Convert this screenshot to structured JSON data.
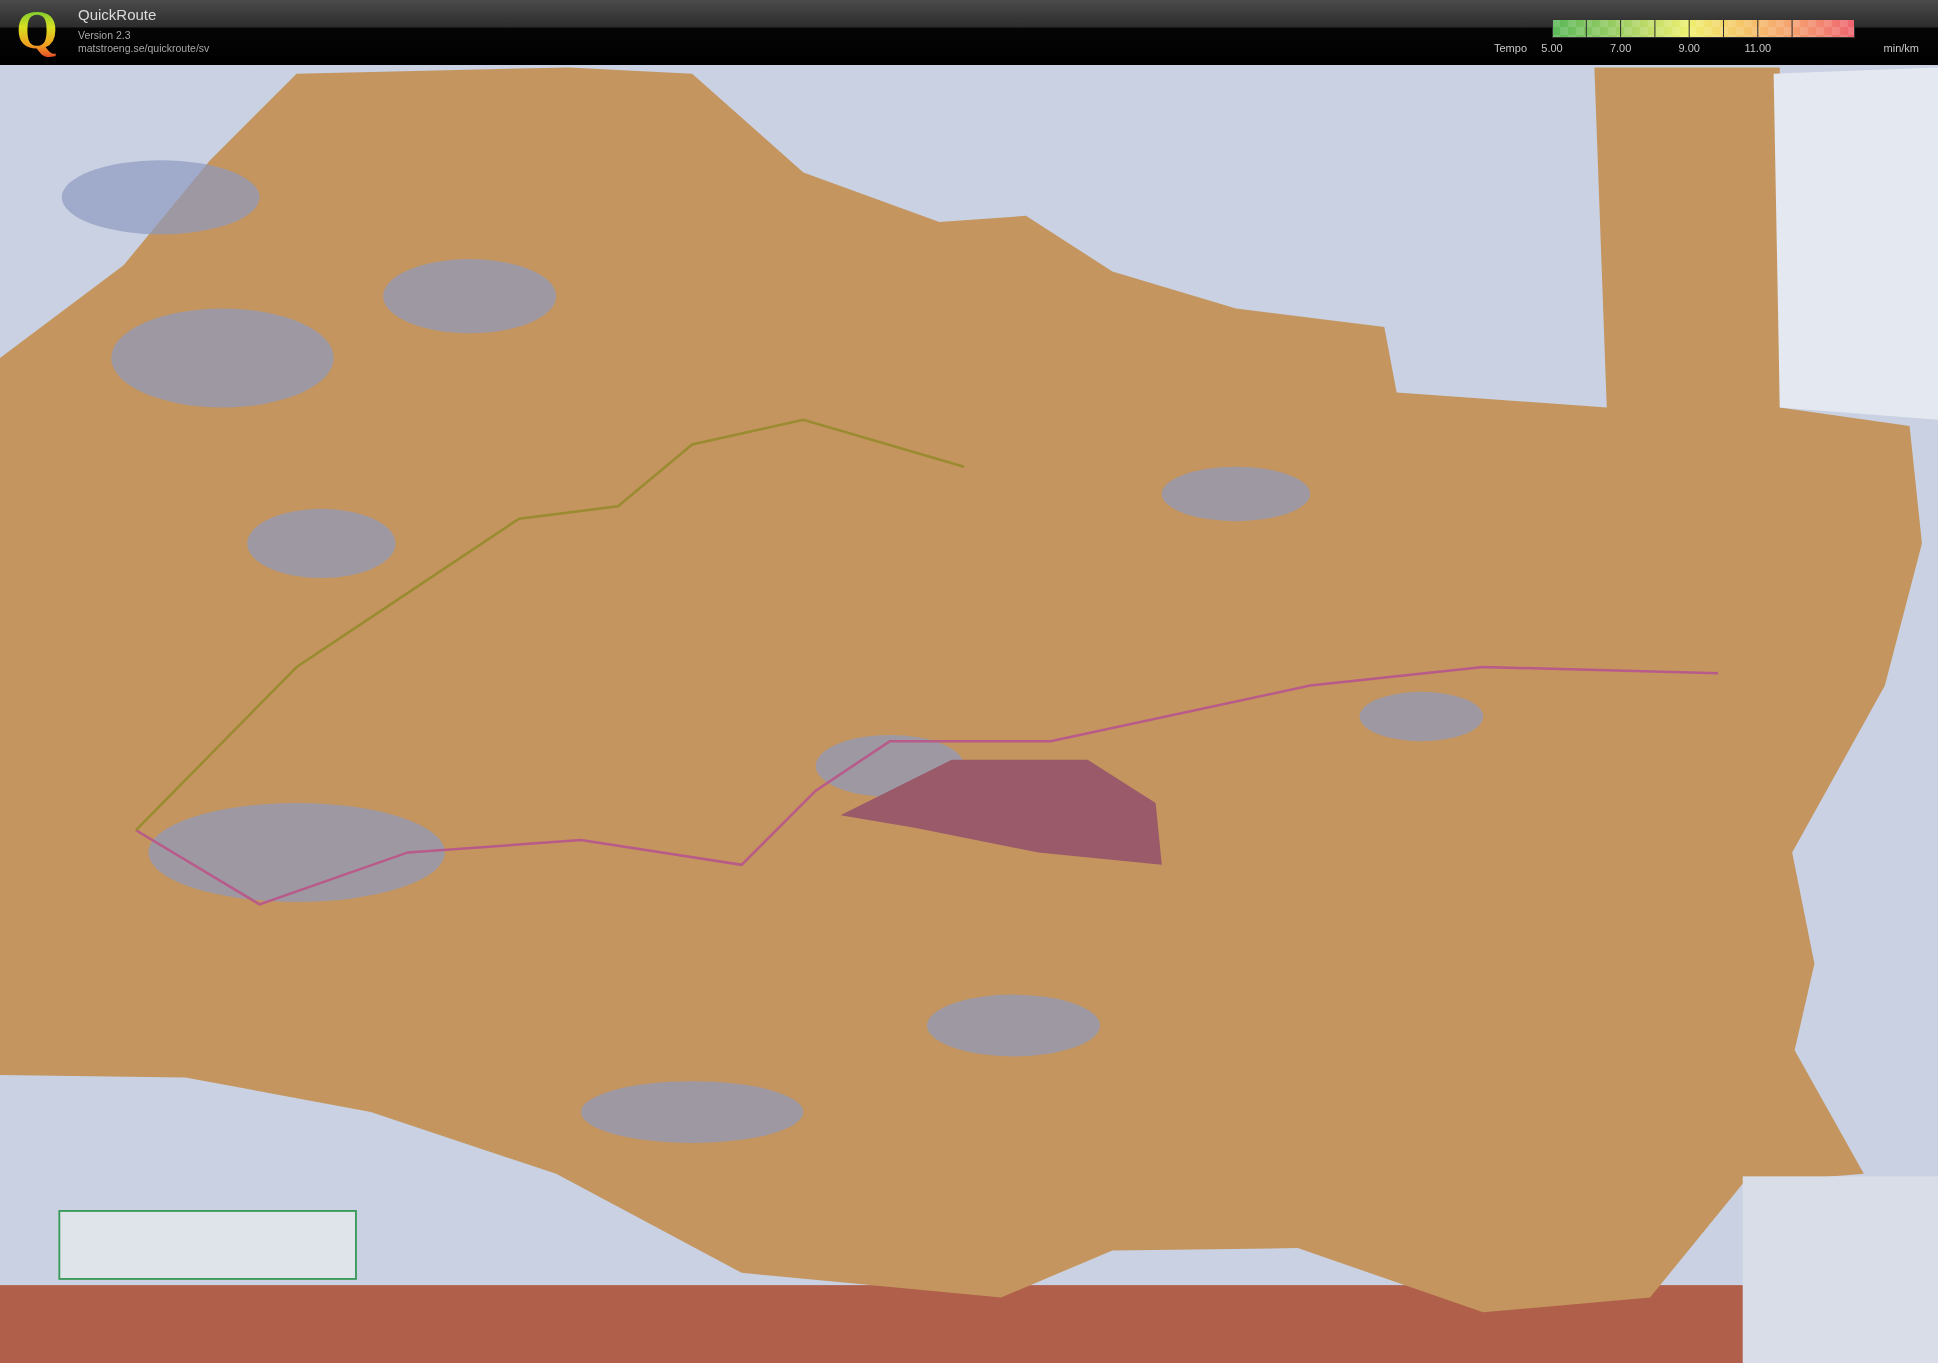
{
  "header": {
    "logo": "Q",
    "app_name": "QuickRoute",
    "version": "Version 2.3",
    "url": "matstroeng.se/quickroute/sv"
  },
  "tempo_legend": {
    "label": "Tempo",
    "ticks": [
      "5.00",
      "7.00",
      "9.00",
      "11.00"
    ],
    "unit": "min/km"
  }
}
